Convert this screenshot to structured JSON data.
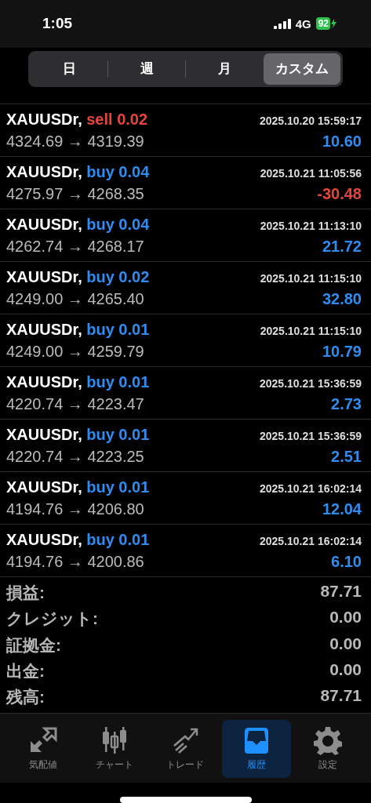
{
  "status_bar": {
    "time": "1:05",
    "network": "4G",
    "battery": "92"
  },
  "period_tabs": [
    {
      "label": "日",
      "selected": false
    },
    {
      "label": "週",
      "selected": false
    },
    {
      "label": "月",
      "selected": false
    },
    {
      "label": "カスタム",
      "selected": true
    }
  ],
  "deals": [
    {
      "symbol": "XAUUSDr,",
      "side": {
        "text": "sell 0.02",
        "color": "#e5453a"
      },
      "time": "2025.10.20 15:59:17",
      "prices": "4324.69 → 4319.39",
      "profit": {
        "text": "10.60",
        "color": "#2f8cf0"
      }
    },
    {
      "symbol": "XAUUSDr,",
      "side": {
        "text": "buy 0.04",
        "color": "#2f8cf0"
      },
      "time": "2025.10.21 11:05:56",
      "prices": "4275.97 → 4268.35",
      "profit": {
        "text": "-30.48",
        "color": "#e5453a"
      }
    },
    {
      "symbol": "XAUUSDr,",
      "side": {
        "text": "buy 0.04",
        "color": "#2f8cf0"
      },
      "time": "2025.10.21 11:13:10",
      "prices": "4262.74 → 4268.17",
      "profit": {
        "text": "21.72",
        "color": "#2f8cf0"
      }
    },
    {
      "symbol": "XAUUSDr,",
      "side": {
        "text": "buy 0.02",
        "color": "#2f8cf0"
      },
      "time": "2025.10.21 11:15:10",
      "prices": "4249.00 → 4265.40",
      "profit": {
        "text": "32.80",
        "color": "#2f8cf0"
      }
    },
    {
      "symbol": "XAUUSDr,",
      "side": {
        "text": "buy 0.01",
        "color": "#2f8cf0"
      },
      "time": "2025.10.21 11:15:10",
      "prices": "4249.00 → 4259.79",
      "profit": {
        "text": "10.79",
        "color": "#2f8cf0"
      }
    },
    {
      "symbol": "XAUUSDr,",
      "side": {
        "text": "buy 0.01",
        "color": "#2f8cf0"
      },
      "time": "2025.10.21 15:36:59",
      "prices": "4220.74 → 4223.47",
      "profit": {
        "text": "2.73",
        "color": "#2f8cf0"
      }
    },
    {
      "symbol": "XAUUSDr,",
      "side": {
        "text": "buy 0.01",
        "color": "#2f8cf0"
      },
      "time": "2025.10.21 15:36:59",
      "prices": "4220.74 → 4223.25",
      "profit": {
        "text": "2.51",
        "color": "#2f8cf0"
      }
    },
    {
      "symbol": "XAUUSDr,",
      "side": {
        "text": "buy 0.01",
        "color": "#2f8cf0"
      },
      "time": "2025.10.21 16:02:14",
      "prices": "4194.76 → 4206.80",
      "profit": {
        "text": "12.04",
        "color": "#2f8cf0"
      }
    },
    {
      "symbol": "XAUUSDr,",
      "side": {
        "text": "buy 0.01",
        "color": "#2f8cf0"
      },
      "time": "2025.10.21 16:02:14",
      "prices": "4194.76 → 4200.86",
      "profit": {
        "text": "6.10",
        "color": "#2f8cf0"
      }
    }
  ],
  "summary": [
    {
      "label": "損益:",
      "value": "87.71"
    },
    {
      "label": "クレジット:",
      "value": "0.00"
    },
    {
      "label": "証拠金:",
      "value": "0.00"
    },
    {
      "label": "出金:",
      "value": "0.00"
    },
    {
      "label": "残高:",
      "value": "87.71"
    }
  ],
  "tab_bar": [
    {
      "label": "気配値",
      "selected": false
    },
    {
      "label": "チャート",
      "selected": false
    },
    {
      "label": "トレード",
      "selected": false
    },
    {
      "label": "履歴",
      "selected": true
    },
    {
      "label": "設定",
      "selected": false
    }
  ]
}
